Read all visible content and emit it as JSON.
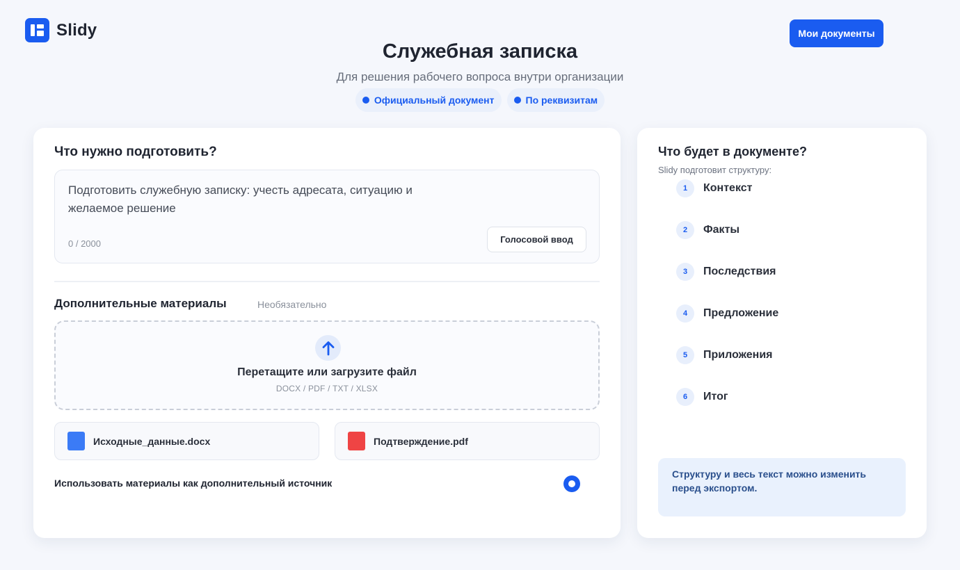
{
  "app": {
    "name": "Slidy",
    "my_documents_label": "Мои документы"
  },
  "header": {
    "title": "Служебная записка",
    "subtitle": "Для решения рабочего вопроса внутри организации",
    "badges": [
      "Официальный документ",
      "По реквизитам"
    ]
  },
  "form": {
    "task_heading": "Что нужно подготовить?",
    "task_text": "Подготовить служебную записку: учесть адресата, ситуацию и желаемое решение",
    "counter": "0 / 2000",
    "voice_button": "Голосовой ввод",
    "materials_heading": "Дополнительные материалы",
    "materials_optional": "Необязательно",
    "dropzone_title": "Перетащите или загрузите файл",
    "dropzone_formats": "DOCX / PDF / TXT / XLSX",
    "files": [
      {
        "name": "Исходные_данные.docx",
        "color": "#3b7bf6"
      },
      {
        "name": "Подтверждение.pdf",
        "color": "#ef4444"
      }
    ],
    "use_materials_label": "Использовать материалы как дополнительный источник",
    "use_materials_selected": true
  },
  "structure": {
    "heading": "Что будет в документе?",
    "subheading": "Slidy подготовит структуру:",
    "steps": [
      {
        "num": "1",
        "label": "Контекст"
      },
      {
        "num": "2",
        "label": "Факты"
      },
      {
        "num": "3",
        "label": "Последствия"
      },
      {
        "num": "4",
        "label": "Предложение"
      },
      {
        "num": "5",
        "label": "Приложения"
      },
      {
        "num": "6",
        "label": "Итог"
      }
    ],
    "note": "Структуру и весь текст можно изменить перед экспортом."
  },
  "colors": {
    "accent": "#1a5cf0",
    "background": "#f5f7fc"
  }
}
